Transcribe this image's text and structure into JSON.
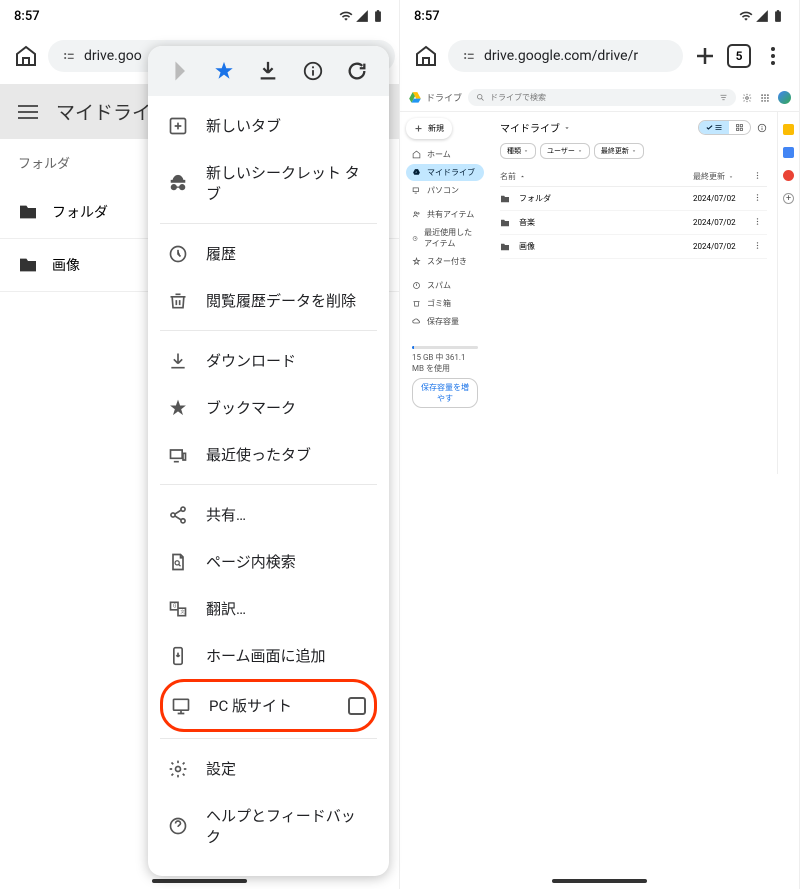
{
  "status": {
    "time": "8:57"
  },
  "leftPhone": {
    "url": "drive.goo",
    "header": {
      "title": "マイドライ"
    },
    "subheader": "フォルダ",
    "folders": [
      "フォルダ",
      "画像"
    ]
  },
  "menu": {
    "newTab": "新しいタブ",
    "newIncognito": "新しいシークレット タブ",
    "history": "履歴",
    "clearData": "閲覧履歴データを削除",
    "downloads": "ダウンロード",
    "bookmarks": "ブックマーク",
    "recentTabs": "最近使ったタブ",
    "share": "共有…",
    "findInPage": "ページ内検索",
    "translate": "翻訳…",
    "addToHome": "ホーム画面に追加",
    "desktopSite": "PC 版サイト",
    "settings": "設定",
    "help": "ヘルプとフィードバック"
  },
  "rightPhone": {
    "url": "drive.google.com/drive/r",
    "tabCount": "5",
    "drive": {
      "logo": "ドライブ",
      "searchPlaceholder": "ドライブで検索",
      "newBtn": "新規",
      "sidebar": {
        "home": "ホーム",
        "myDrive": "マイドライブ",
        "computers": "パソコン",
        "shared": "共有アイテム",
        "recent": "最近使用したアイテム",
        "starred": "スター付き",
        "spam": "スパム",
        "trash": "ゴミ箱",
        "storage": "保存容量"
      },
      "storageText": "15 GB 中 361.1 MB を使用",
      "storageBtn": "保存容量を増やす",
      "breadcrumb": "マイドライブ",
      "filters": {
        "type": "種類",
        "user": "ユーザー",
        "modified": "最終更新"
      },
      "columns": {
        "name": "名前",
        "modified": "最終更新"
      },
      "rows": [
        {
          "name": "フォルダ",
          "date": "2024/07/02"
        },
        {
          "name": "音楽",
          "date": "2024/07/02"
        },
        {
          "name": "画像",
          "date": "2024/07/02"
        }
      ]
    }
  }
}
